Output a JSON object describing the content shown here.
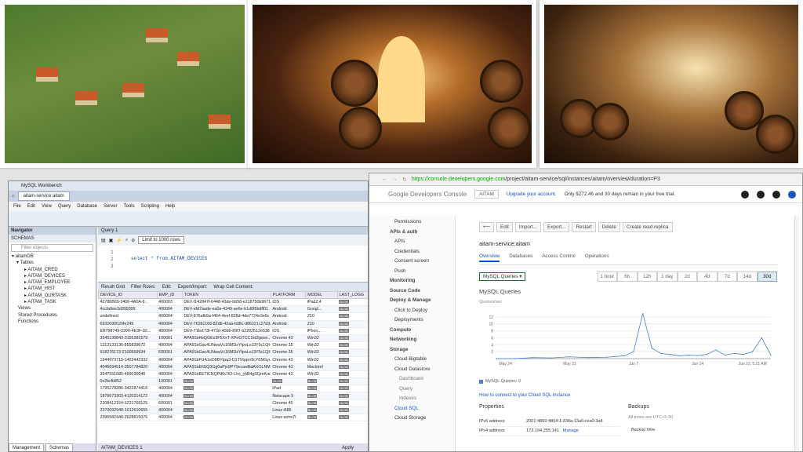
{
  "workbench": {
    "app_title": "MySQL Workbench",
    "connection_tab": "aitam-service:aitam",
    "menu": [
      "File",
      "Edit",
      "View",
      "Query",
      "Database",
      "Server",
      "Tools",
      "Scripting",
      "Help"
    ],
    "navigator_header": "Navigator",
    "schemas_header": "SCHEMAS",
    "filter_placeholder": "Filter objects",
    "tree": [
      "aitamDB",
      "Tables",
      "AITAM_CRED",
      "AITAM_DEVICES",
      "AITAM_EMPLOYEE",
      "AITAM_HIST",
      "AITAM_OURTASK",
      "AITAM_TASK",
      "Views",
      "Stored Procedures",
      "Functions"
    ],
    "bottom_tabs": [
      "Management",
      "Schemas"
    ],
    "query_tab": "Query 1",
    "limit_select": "Limit to 1000 rows",
    "line_numbers": [
      "1",
      "2",
      "3"
    ],
    "query_text": "select * from AITAM_DEVICES",
    "result_toolbar": [
      "Result Grid",
      "Filter Rows:",
      "Edit:",
      "Export/Import:",
      "Wrap Cell Content:"
    ],
    "columns": [
      "DEVICE_ID",
      "EMP_ID",
      "TOKEN",
      "PLATFORM",
      "MODEL",
      "LAST_LOGG"
    ],
    "blob": "BLOB",
    "rows": [
      [
        "42786B69-3406-4A0A-8...",
        "400003",
        "DEV-f142847f-6448-43de-bb58-e218750b9671",
        "iOS",
        "iPad2,4",
        ""
      ],
      [
        "4ccfa9ee3d399395",
        "400004",
        "DEV-efd7aade-ea0e-4349-ae6e-b1d0f6bdff01",
        "Android",
        "Googl...",
        ""
      ],
      [
        "undefined",
        "400004",
        "DEV-876afb5a-f464-4eef-828d-4de7724e3e6c",
        "Android",
        "Z10",
        ""
      ],
      [
        "6932090520fe249",
        "400004",
        "DEV-7636c166-82db-42aa-b98c-d86221c27d3a",
        "Android",
        "Z10",
        ""
      ],
      [
        "EB798749-3390-4E3F-82...",
        "400004",
        "DEV-71fa173f-473d-40b6-89f7-b2202512e538",
        "iOS",
        "iPhon...",
        ""
      ],
      [
        "3545130843-3155381579",
        "100001",
        "APA91bHsQGEz3F5XxT-XPeGTCC1kt2ljsion...",
        "Chrome 43",
        "Win32",
        ""
      ],
      [
        "1313133136-855839672",
        "400004",
        "APA91bGac4LlNwaVc16MDzYfpoLoJ3Y5c1QHM...",
        "Chrome 35",
        "Win32",
        ""
      ],
      [
        "918276173-2100559934",
        "600001",
        "APA91bGac4LlNwaVc16MDzYfpoLoJ3Y5c1QHM...",
        "Chrome 35",
        "Win32",
        ""
      ],
      [
        "1944973715-1422442332",
        "400004",
        "APA91bFUA1eD8BYtpq3-D1TVtpprr9cY6NGyu4...",
        "Chrome 43",
        "Win32",
        ""
      ],
      [
        "4046694514-3507784820",
        "400004",
        "APA91bEfiSQ3Gg0aPjo9PY9vcawBdAXOLNMl...",
        "Chrome 43",
        "MacIntel",
        ""
      ],
      [
        "3547551685-489036040",
        "400004",
        "APA91bEETlCNQPtKk7tO-Lhx_ykB4gSQmKnd9...",
        "Chrome 43",
        "Win32",
        ""
      ],
      [
        "0x2bcfb852",
        "100001",
        "",
        "",
        "",
        ""
      ],
      [
        "1795278286-3422874416",
        "400004",
        "",
        "iPad",
        "",
        ""
      ],
      [
        "1876673303-4120314172",
        "400004",
        "",
        "Netscape 5",
        "",
        ""
      ],
      [
        "2208412154-1221769125",
        "600001",
        "",
        "Chrome 40",
        "",
        ""
      ],
      [
        "2370092948-1012610655",
        "400004",
        "",
        "Linux i686",
        "",
        ""
      ],
      [
        "2395582448-2628815076",
        "400004",
        "",
        "Linux armv7l",
        "",
        ""
      ]
    ],
    "status": "AITAM_DEVICES 1",
    "apply": "Apply"
  },
  "console": {
    "url_host": "https://console.developers.google.com",
    "url_path": "/project/aitam-service/sql/instances/aitam/overview/duration=P3",
    "brand": "Google Developers Console",
    "project": "AITAM",
    "upgrade_link": "Upgrade your account.",
    "upgrade_text": "Only $272.46 and 30 days remain in your free trial.",
    "sidebar": [
      {
        "label": "Permissions",
        "level": "sub"
      },
      {
        "label": "APIs & auth",
        "level": "grp"
      },
      {
        "label": "APIs",
        "level": "sub"
      },
      {
        "label": "Credentials",
        "level": "sub"
      },
      {
        "label": "Consent screen",
        "level": "sub"
      },
      {
        "label": "Push",
        "level": "sub"
      },
      {
        "label": "Monitoring",
        "level": "grp"
      },
      {
        "label": "Source Code",
        "level": "grp"
      },
      {
        "label": "Deploy & Manage",
        "level": "grp"
      },
      {
        "label": "Click to Deploy",
        "level": "sub"
      },
      {
        "label": "Deployments",
        "level": "sub"
      },
      {
        "label": "Compute",
        "level": "grp"
      },
      {
        "label": "Networking",
        "level": "grp"
      },
      {
        "label": "Storage",
        "level": "grp"
      },
      {
        "label": "Cloud Bigtable",
        "level": "sub"
      },
      {
        "label": "Cloud Datastore",
        "level": "sub"
      },
      {
        "label": "Dashboard",
        "level": "sub2"
      },
      {
        "label": "Query",
        "level": "sub2"
      },
      {
        "label": "Indexes",
        "level": "sub2"
      },
      {
        "label": "Cloud SQL",
        "level": "sub active"
      },
      {
        "label": "Cloud Storage",
        "level": "sub"
      }
    ],
    "actions": [
      "Edit",
      "Import...",
      "Export...",
      "Restart",
      "Delete",
      "Create read replica"
    ],
    "instance": "aitam-service:aitam",
    "tabs": [
      "Overview",
      "Databases",
      "Access Control",
      "Operations"
    ],
    "metric_select": "MySQL Queries",
    "ranges": [
      "1 hour",
      "6h",
      "12h",
      "1 day",
      "2d",
      "4d",
      "7d",
      "14d",
      "30d"
    ],
    "chart_title": "MySQL Queries",
    "legend": "MySQL Queries: 0",
    "connect_link": "How to connect to your Cloud SQL instance",
    "properties_title": "Properties",
    "backups_title": "Backups",
    "backups_note": "All times are UTC+5:30",
    "backup_time": "Backup time",
    "manage": "Manage",
    "properties": [
      [
        "IPv6 address",
        "2001:4860:4864:1:338a:13a5:cea0:3a4"
      ],
      [
        "IPv4 address",
        "173.194.255.141"
      ]
    ]
  },
  "chart_data": {
    "type": "line",
    "title": "MySQL Queries",
    "ylabel": "Queries/sec",
    "ylim": [
      0,
      14
    ],
    "yticks": [
      2,
      4,
      6,
      8,
      10,
      12
    ],
    "xtick_labels": [
      "May 24",
      "May 31",
      "Jun 7",
      "Jun 14",
      "Jun 22, 5:21 AM"
    ],
    "x": [
      0,
      2,
      4,
      6,
      8,
      10,
      12,
      14,
      15,
      16,
      17,
      18,
      19,
      20,
      21,
      22,
      23,
      24,
      25,
      26,
      27,
      28,
      29,
      30
    ],
    "series": [
      {
        "values": [
          0,
          0,
          0.3,
          0.2,
          0.5,
          0.3,
          0.4,
          0.8,
          2,
          13,
          3,
          1.5,
          1.2,
          0.8,
          1,
          0.9,
          1.2,
          2.5,
          1,
          1.5,
          1.2,
          2,
          6,
          1
        ]
      }
    ]
  }
}
